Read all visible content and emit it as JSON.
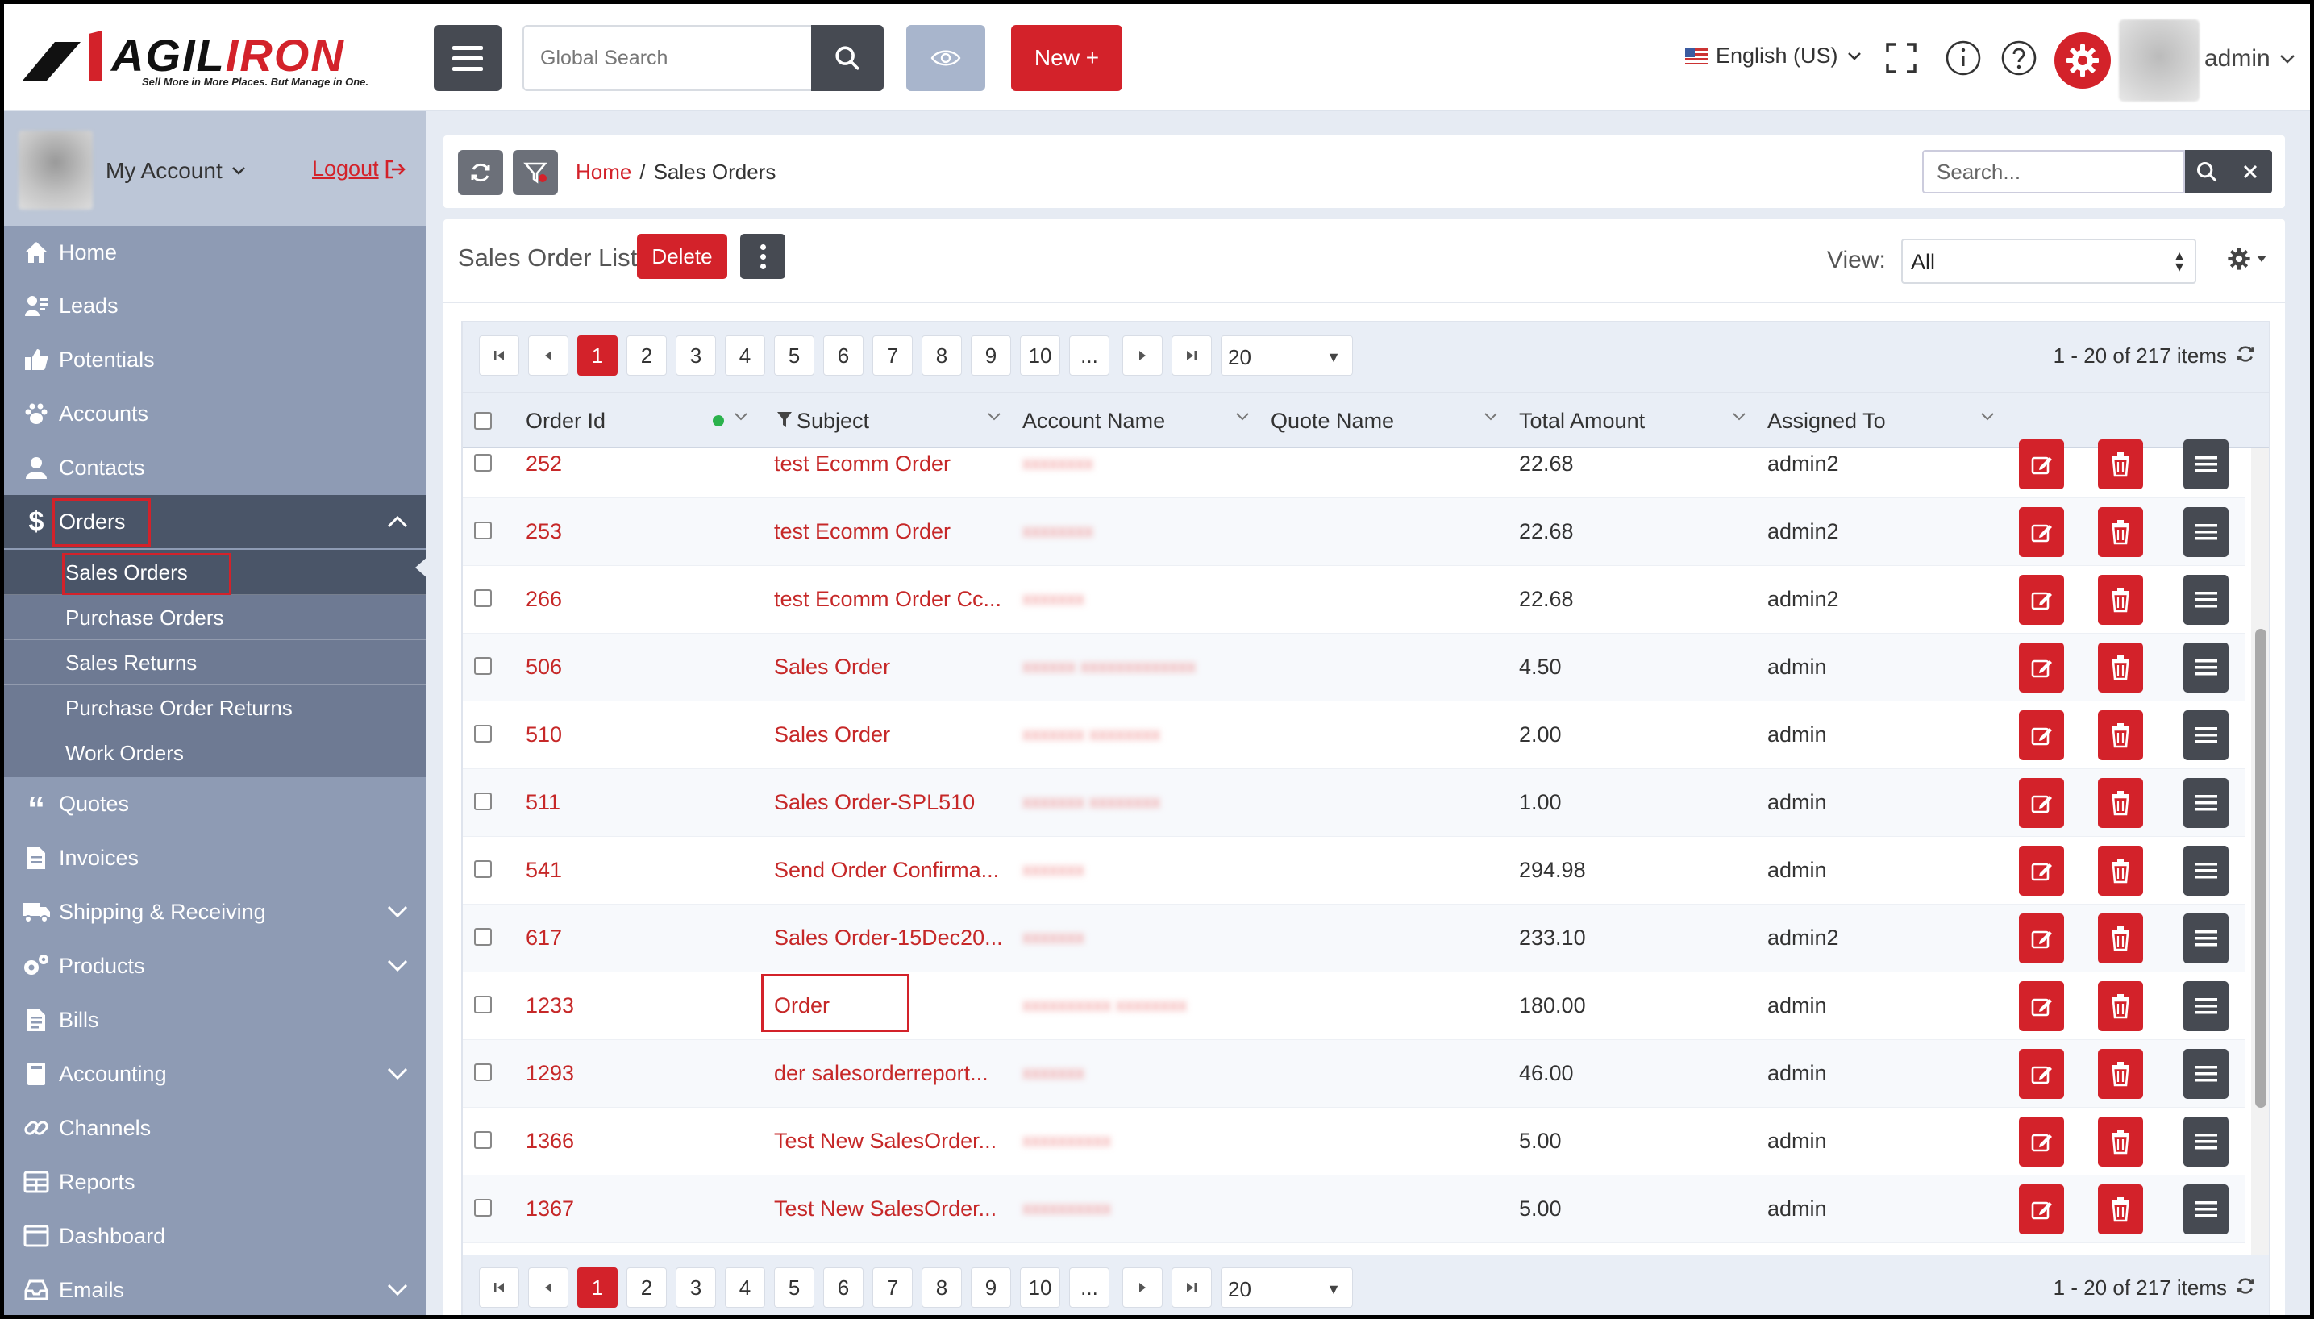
{
  "brand": {
    "logo_text_black": "AGIL",
    "logo_text_red": "IRON",
    "tagline": "Sell More in More Places. But Manage in One."
  },
  "header": {
    "search_placeholder": "Global Search",
    "new_label": "New +",
    "language": "English (US)",
    "user": "admin"
  },
  "sidebar": {
    "account_label": "My Account",
    "logout_label": "Logout",
    "items": [
      {
        "label": "Home",
        "icon": "home-icon"
      },
      {
        "label": "Leads",
        "icon": "leads-icon"
      },
      {
        "label": "Potentials",
        "icon": "thumbs-up-icon"
      },
      {
        "label": "Accounts",
        "icon": "paw-icon"
      },
      {
        "label": "Contacts",
        "icon": "user-icon"
      },
      {
        "label": "Orders",
        "icon": "dollar-icon"
      },
      {
        "label": "Quotes",
        "icon": "quote-icon"
      },
      {
        "label": "Invoices",
        "icon": "document-icon"
      },
      {
        "label": "Shipping & Receiving",
        "icon": "truck-icon"
      },
      {
        "label": "Products",
        "icon": "gears-icon"
      },
      {
        "label": "Bills",
        "icon": "bill-icon"
      },
      {
        "label": "Accounting",
        "icon": "book-icon"
      },
      {
        "label": "Channels",
        "icon": "link-icon"
      },
      {
        "label": "Reports",
        "icon": "table-icon"
      },
      {
        "label": "Dashboard",
        "icon": "dashboard-icon"
      },
      {
        "label": "Emails",
        "icon": "inbox-icon"
      }
    ],
    "orders_sub": [
      "Sales Orders",
      "Purchase Orders",
      "Sales Returns",
      "Purchase Order Returns",
      "Work Orders"
    ]
  },
  "breadcrumb": {
    "home": "Home",
    "sep": "/",
    "current": "Sales Orders"
  },
  "toolbar": {
    "search_placeholder": "Search..."
  },
  "panel": {
    "title": "Sales Order List",
    "delete_label": "Delete",
    "view_label": "View:",
    "view_value": "All"
  },
  "pager": {
    "pages": [
      "1",
      "2",
      "3",
      "4",
      "5",
      "6",
      "7",
      "8",
      "9",
      "10",
      "..."
    ],
    "active_page": "1",
    "page_size": "20",
    "info": "1 - 20 of 217 items"
  },
  "table": {
    "columns": [
      "Order Id",
      "Subject",
      "Account Name",
      "Quote Name",
      "Total Amount",
      "Assigned To"
    ],
    "rows": [
      {
        "id": "252",
        "subject": "test Ecomm Order",
        "account": "xxxxxxxx",
        "quote": "",
        "amount": "22.68",
        "assigned": "admin2"
      },
      {
        "id": "253",
        "subject": "test Ecomm Order",
        "account": "xxxxxxxx",
        "quote": "",
        "amount": "22.68",
        "assigned": "admin2"
      },
      {
        "id": "266",
        "subject": "test Ecomm Order Cc...",
        "account": "xxxxxxx",
        "quote": "",
        "amount": "22.68",
        "assigned": "admin2"
      },
      {
        "id": "506",
        "subject": "Sales Order",
        "account": "xxxxxx xxxxxxxxxxxxx",
        "quote": "",
        "amount": "4.50",
        "assigned": "admin"
      },
      {
        "id": "510",
        "subject": "Sales Order",
        "account": "xxxxxxx xxxxxxxx",
        "quote": "",
        "amount": "2.00",
        "assigned": "admin"
      },
      {
        "id": "511",
        "subject": "Sales Order-SPL510",
        "account": "xxxxxxx xxxxxxxx",
        "quote": "",
        "amount": "1.00",
        "assigned": "admin"
      },
      {
        "id": "541",
        "subject": "Send Order Confirma...",
        "account": "xxxxxxx",
        "quote": "",
        "amount": "294.98",
        "assigned": "admin"
      },
      {
        "id": "617",
        "subject": "Sales Order-15Dec20...",
        "account": "xxxxxxx",
        "quote": "",
        "amount": "233.10",
        "assigned": "admin2"
      },
      {
        "id": "1233",
        "subject": "Order",
        "account": "xxxxxxxxxx xxxxxxxx",
        "quote": "",
        "amount": "180.00",
        "assigned": "admin"
      },
      {
        "id": "1293",
        "subject": "der salesorderreport...",
        "account": "xxxxxxx",
        "quote": "",
        "amount": "46.00",
        "assigned": "admin"
      },
      {
        "id": "1366",
        "subject": "Test New SalesOrder...",
        "account": "xxxxxxxxxx",
        "quote": "",
        "amount": "5.00",
        "assigned": "admin"
      },
      {
        "id": "1367",
        "subject": "Test New SalesOrder...",
        "account": "xxxxxxxxxx",
        "quote": "",
        "amount": "5.00",
        "assigned": "admin"
      }
    ]
  },
  "colors": {
    "accent": "#d3222a",
    "sidebar": "#8e9bb4",
    "dark_button": "#464a52"
  }
}
